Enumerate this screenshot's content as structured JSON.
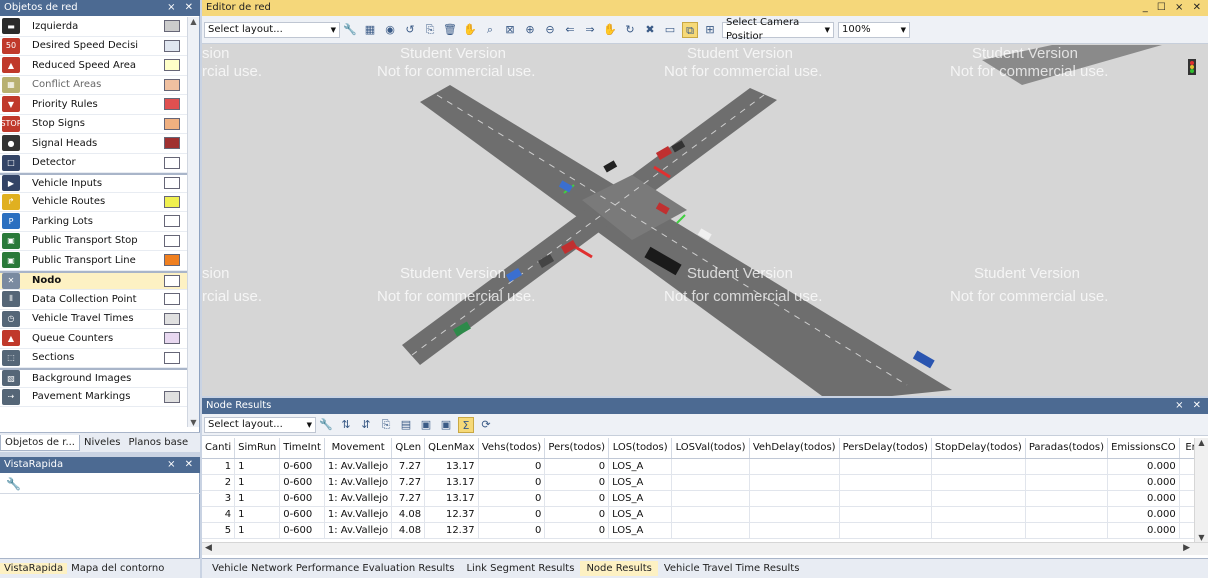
{
  "left_panel": {
    "title": "Objetos de red",
    "controls": "⨯ ✕",
    "items": [
      {
        "label": "Izquierda",
        "icon": "road-icon",
        "icon_text": "▬",
        "icon_bg": "#2b2b2b",
        "swatch": "#cccccc"
      },
      {
        "label": "Desired Speed Decisi",
        "icon": "speed-sign-icon",
        "icon_text": "50",
        "icon_bg": "#c0392b",
        "swatch": "#e0e6f0"
      },
      {
        "label": "Reduced Speed Area",
        "icon": "warning-sign-icon",
        "icon_text": "▲",
        "icon_bg": "#c0392b",
        "swatch": "#ffffc8"
      },
      {
        "label": "Conflict Areas",
        "icon": "conflict-icon",
        "icon_text": "▦",
        "icon_bg": "#b8b070",
        "swatch": "#f0c0a0",
        "dim": true
      },
      {
        "label": "Priority Rules",
        "icon": "yield-sign-icon",
        "icon_text": "▼",
        "icon_bg": "#c0392b",
        "swatch": "#e05050"
      },
      {
        "label": "Stop Signs",
        "icon": "stop-sign-icon",
        "icon_text": "STOP",
        "icon_bg": "#c0392b",
        "swatch": "#f0b080"
      },
      {
        "label": "Signal Heads",
        "icon": "traffic-light-icon",
        "icon_text": "●",
        "icon_bg": "#333333",
        "swatch": "#a03030"
      },
      {
        "label": "Detector",
        "icon": "detector-icon",
        "icon_text": "□",
        "icon_bg": "#334466",
        "swatch": "#ffffff"
      },
      {
        "label": "Vehicle Inputs",
        "icon": "vehicle-input-icon",
        "icon_text": "▶",
        "icon_bg": "#334466",
        "swatch": "#ffffff",
        "sep": true
      },
      {
        "label": "Vehicle Routes",
        "icon": "route-icon",
        "icon_text": "↱",
        "icon_bg": "#e0b020",
        "swatch": "#f0f050"
      },
      {
        "label": "Parking Lots",
        "icon": "parking-icon",
        "icon_text": "P",
        "icon_bg": "#2a6fc0",
        "swatch": "#ffffff"
      },
      {
        "label": "Public Transport Stop",
        "icon": "bus-stop-icon",
        "icon_text": "▣",
        "icon_bg": "#2a7a3a",
        "swatch": "#ffffff"
      },
      {
        "label": "Public Transport Line",
        "icon": "bus-line-icon",
        "icon_text": "▣",
        "icon_bg": "#2a7a3a",
        "swatch": "#f08020"
      },
      {
        "label": "Nodo",
        "icon": "node-icon",
        "icon_text": "✕",
        "icon_bg": "#7a8aa0",
        "swatch": "#ffffff",
        "sep": true,
        "selected": true
      },
      {
        "label": "Data Collection Point",
        "icon": "data-point-icon",
        "icon_text": "⦀",
        "icon_bg": "#556677",
        "swatch": "#ffffff"
      },
      {
        "label": "Vehicle Travel Times",
        "icon": "stopwatch-icon",
        "icon_text": "◷",
        "icon_bg": "#556677",
        "swatch": "#e0e0e0"
      },
      {
        "label": "Queue Counters",
        "icon": "queue-icon",
        "icon_text": "▲",
        "icon_bg": "#c0392b",
        "swatch": "#e8d8f0"
      },
      {
        "label": "Sections",
        "icon": "section-icon",
        "icon_text": "⬚",
        "icon_bg": "#556677",
        "swatch": "#ffffff"
      },
      {
        "label": "Background Images",
        "icon": "image-icon",
        "icon_text": "▧",
        "icon_bg": "#556677",
        "swatch": "",
        "sep": true
      },
      {
        "label": "Pavement Markings",
        "icon": "pavement-icon",
        "icon_text": "⇢",
        "icon_bg": "#556677",
        "swatch": "#e0e0e0"
      }
    ],
    "tabs": [
      "Objetos de r...",
      "Niveles",
      "Planos base"
    ]
  },
  "vista": {
    "title": "VistaRapida",
    "controls": "⨯ ✕",
    "tabs": [
      "VistaRapida",
      "Mapa del contorno"
    ]
  },
  "editor": {
    "title": "Editor de red",
    "controls": "_ ☐ ⨯ ✕",
    "layout_select": "Select layout...",
    "camera_select": "Select Camera Positior",
    "zoom": "100%",
    "watermark_student": "Student Version",
    "watermark_commercial": "Not for commercial use.",
    "watermark_partial_1": "sion",
    "watermark_partial_2": "rcial use."
  },
  "results": {
    "title": "Node Results",
    "layout_select": "Select layout...",
    "columns": [
      "Canti",
      "SimRun",
      "TimeInt",
      "Movement",
      "QLen",
      "QLenMax",
      "Vehs(todos)",
      "Pers(todos)",
      "LOS(todos)",
      "LOSVal(todos)",
      "VehDelay(todos)",
      "PersDelay(todos)",
      "StopDelay(todos)",
      "Paradas(todos)",
      "EmissionsCO",
      "Em"
    ],
    "rows": [
      [
        "1",
        "1",
        "0-600",
        "1: Av.Vallejo",
        "7.27",
        "13.17",
        "0",
        "0",
        "LOS_A",
        "",
        "",
        "",
        "",
        "",
        "0.000",
        ""
      ],
      [
        "2",
        "1",
        "0-600",
        "1: Av.Vallejo",
        "7.27",
        "13.17",
        "0",
        "0",
        "LOS_A",
        "",
        "",
        "",
        "",
        "",
        "0.000",
        ""
      ],
      [
        "3",
        "1",
        "0-600",
        "1: Av.Vallejo",
        "7.27",
        "13.17",
        "0",
        "0",
        "LOS_A",
        "",
        "",
        "",
        "",
        "",
        "0.000",
        ""
      ],
      [
        "4",
        "1",
        "0-600",
        "1: Av.Vallejo",
        "4.08",
        "12.37",
        "0",
        "0",
        "LOS_A",
        "",
        "",
        "",
        "",
        "",
        "0.000",
        ""
      ],
      [
        "5",
        "1",
        "0-600",
        "1: Av.Vallejo",
        "4.08",
        "12.37",
        "0",
        "0",
        "LOS_A",
        "",
        "",
        "",
        "",
        "",
        "0.000",
        ""
      ]
    ],
    "tabs": [
      "Vehicle Network Performance Evaluation Results",
      "Link Segment Results",
      "Node Results",
      "Vehicle Travel Time Results"
    ],
    "active_tab": 2
  },
  "colors": {
    "header_blue": "#4c6a92",
    "header_yellow": "#f5d77a",
    "road": "#6e6e6e",
    "canvas": "#d6d6d6"
  }
}
